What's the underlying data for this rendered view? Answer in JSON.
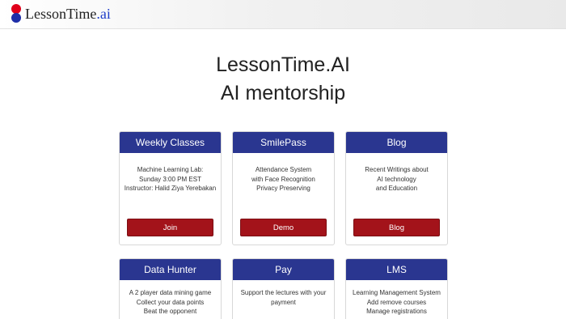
{
  "brand": {
    "name": "LessonTime",
    "suffix": ".ai"
  },
  "hero": {
    "line1": "LessonTime.AI",
    "line2": "AI mentorship"
  },
  "cards": [
    {
      "title": "Weekly Classes",
      "lines": [
        "Machine Learning Lab:",
        "Sunday 3:00 PM EST",
        "Instructor: Halid Ziya Yerebakan"
      ],
      "button": "Join"
    },
    {
      "title": "SmilePass",
      "lines": [
        "Attendance System",
        "with Face Recognition",
        "Privacy Preserving"
      ],
      "button": "Demo"
    },
    {
      "title": "Blog",
      "lines": [
        "Recent Writings about",
        "AI technology",
        "and Education"
      ],
      "button": "Blog"
    },
    {
      "title": "Data Hunter",
      "lines": [
        "A 2 player data mining game",
        "Collect your data points",
        "Beat the opponent"
      ]
    },
    {
      "title": "Pay",
      "lines": [
        "Support the lectures with your",
        "payment"
      ]
    },
    {
      "title": "LMS",
      "lines": [
        "Learning Management System",
        "Add remove courses",
        "Manage registrations"
      ]
    }
  ],
  "colors": {
    "card_header": "#2a3690",
    "button": "#a3131a",
    "logo_red": "#e0001a",
    "logo_blue": "#1e2ea8"
  }
}
